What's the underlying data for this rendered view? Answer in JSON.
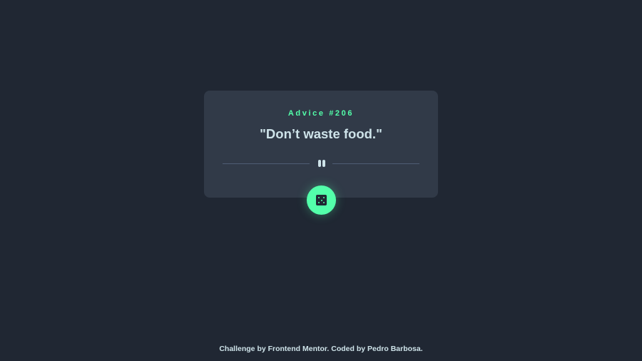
{
  "advice": {
    "id_label": "Advice #206",
    "text": "\"Don’t waste food.\""
  },
  "divider": {
    "icon": "pause-icon"
  },
  "dice_button": {
    "icon": "dice-icon"
  },
  "footer": {
    "text": "Challenge by Frontend Mentor. Coded by Pedro Barbosa."
  },
  "colors": {
    "background": "#202733",
    "card": "#313a48",
    "accent": "#53ffaa",
    "text": "#cee3e9",
    "divider": "#4f5d74"
  }
}
